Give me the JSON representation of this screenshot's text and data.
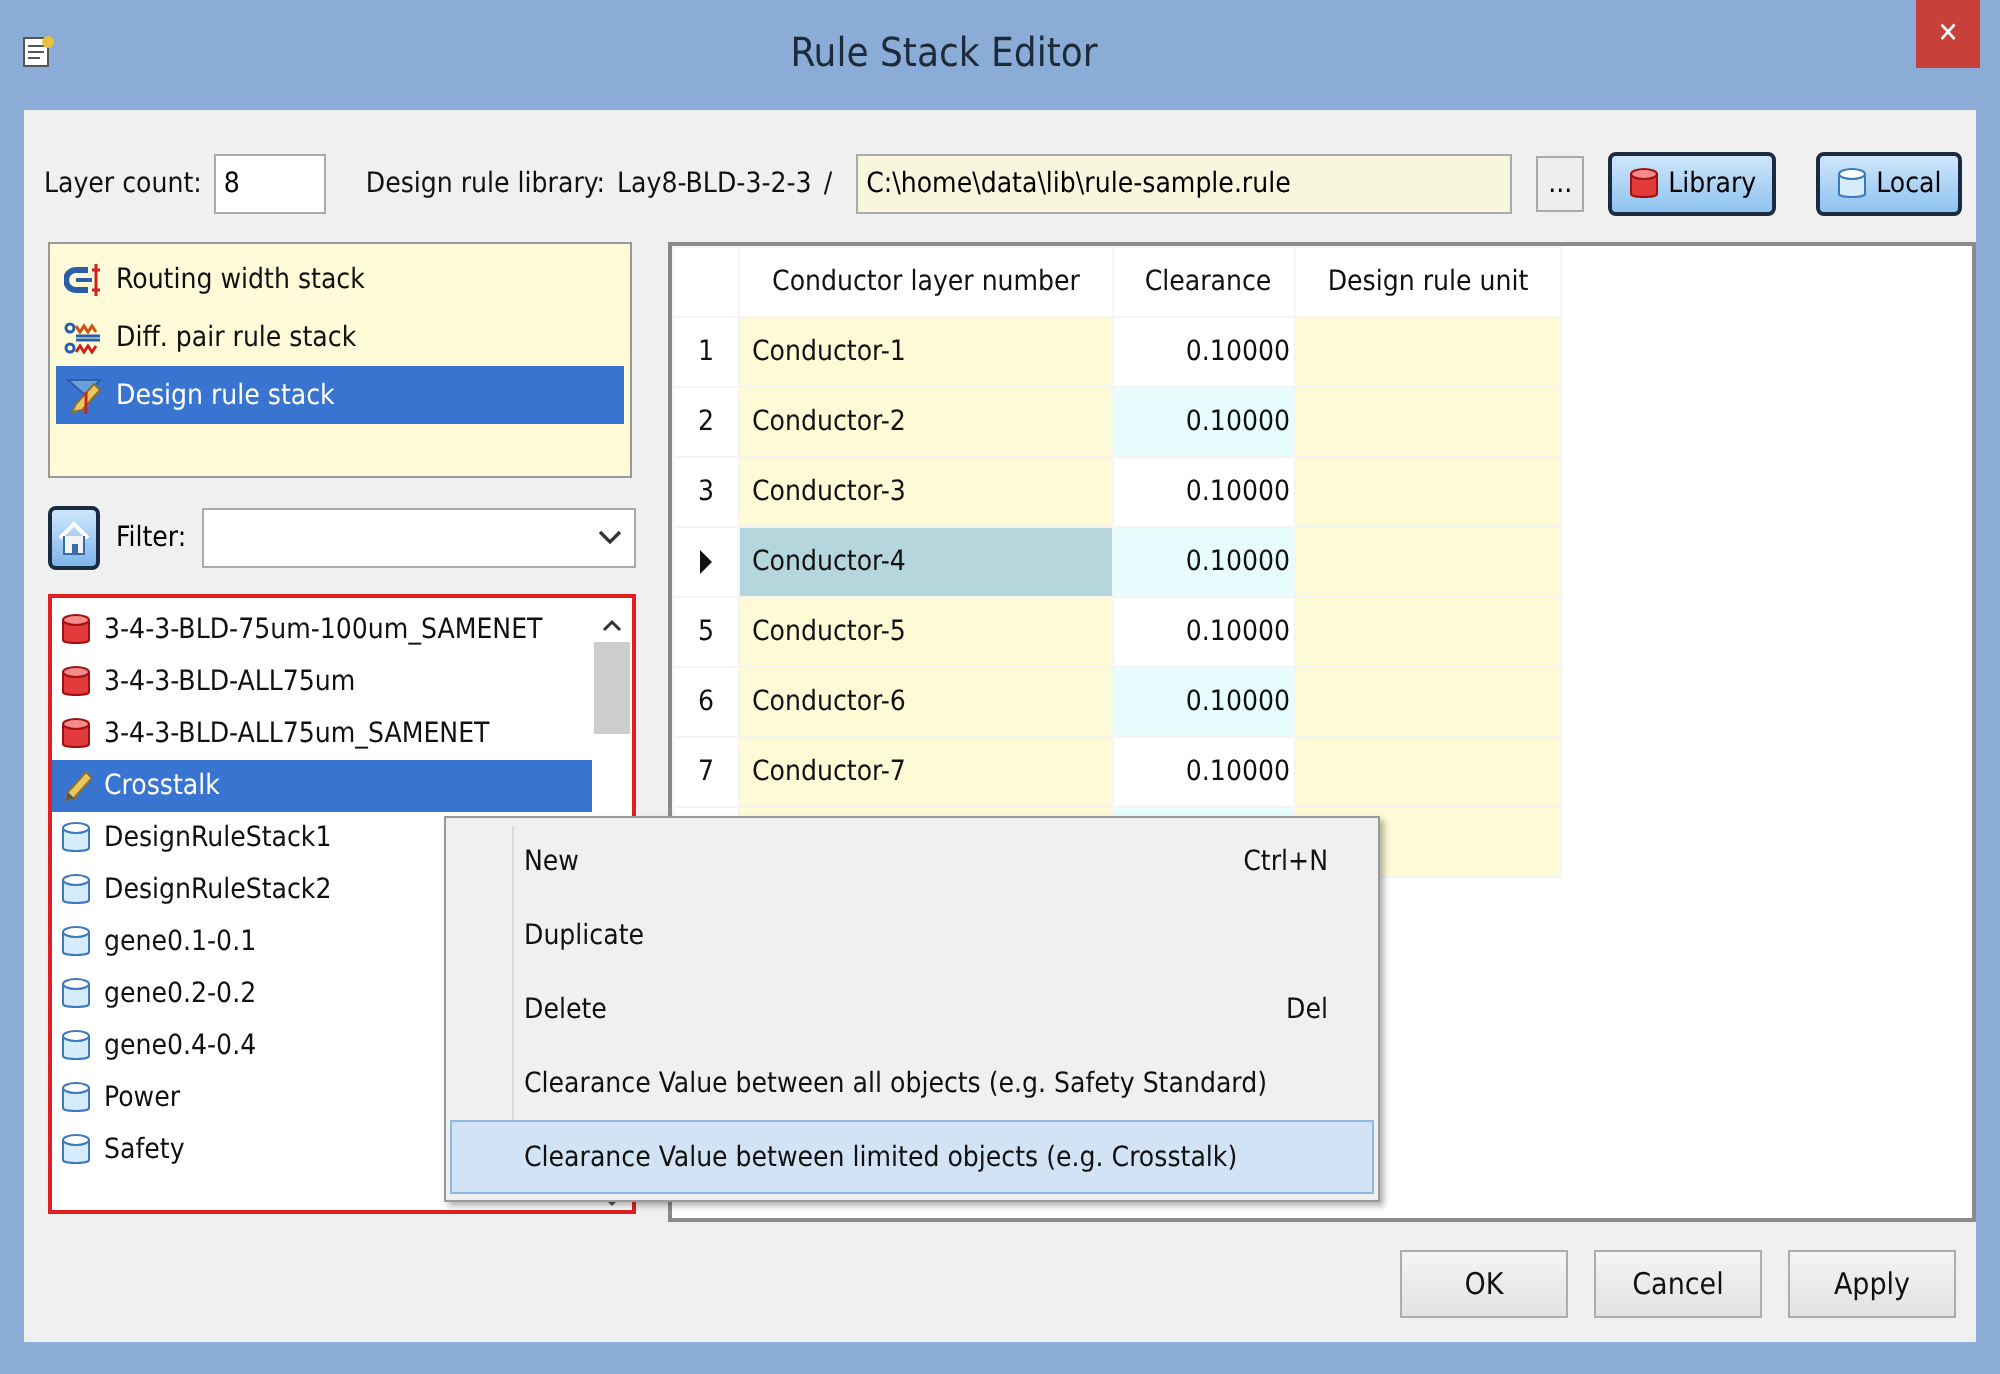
{
  "window": {
    "title": "Rule Stack Editor",
    "close": "✕"
  },
  "toolbar": {
    "layer_count_label": "Layer count:",
    "layer_count": "8",
    "library_label": "Design rule library:",
    "library_name": "Lay8-BLD-3-2-3",
    "separator": "/",
    "library_path": "C:\\home\\data\\lib\\rule-sample.rule",
    "browse": "...",
    "library_button": "Library",
    "local_button": "Local"
  },
  "stack_types": [
    {
      "label": "Routing width stack",
      "kind": "routing",
      "selected": false
    },
    {
      "label": "Diff. pair rule stack",
      "kind": "diffpair",
      "selected": false
    },
    {
      "label": "Design rule stack",
      "kind": "design",
      "selected": true
    }
  ],
  "filter": {
    "label": "Filter:"
  },
  "rule_stacks": [
    {
      "label": "3-4-3-BLD-75um-100um_SAMENET",
      "kind": "library",
      "selected": false
    },
    {
      "label": "3-4-3-BLD-ALL75um",
      "kind": "library",
      "selected": false
    },
    {
      "label": "3-4-3-BLD-ALL75um_SAMENET",
      "kind": "library",
      "selected": false
    },
    {
      "label": "Crosstalk",
      "kind": "edit",
      "selected": true
    },
    {
      "label": "DesignRuleStack1",
      "kind": "local",
      "selected": false
    },
    {
      "label": "DesignRuleStack2",
      "kind": "local",
      "selected": false
    },
    {
      "label": "gene0.1-0.1",
      "kind": "local",
      "selected": false
    },
    {
      "label": "gene0.2-0.2",
      "kind": "local",
      "selected": false
    },
    {
      "label": "gene0.4-0.4",
      "kind": "local",
      "selected": false
    },
    {
      "label": "Power",
      "kind": "local",
      "selected": false
    },
    {
      "label": "Safety",
      "kind": "local",
      "selected": false
    }
  ],
  "table": {
    "columns": [
      "Conductor layer number",
      "Clearance",
      "Design rule unit"
    ],
    "rows": [
      {
        "number": "1",
        "layer": "Conductor-1",
        "clearance": "0.10000",
        "current": false
      },
      {
        "number": "2",
        "layer": "Conductor-2",
        "clearance": "0.10000",
        "current": false
      },
      {
        "number": "3",
        "layer": "Conductor-3",
        "clearance": "0.10000",
        "current": false
      },
      {
        "layer": "Conductor-4",
        "clearance": "0.10000",
        "current": true
      },
      {
        "number": "5",
        "layer": "Conductor-5",
        "clearance": "0.10000",
        "current": false
      },
      {
        "number": "6",
        "layer": "Conductor-6",
        "clearance": "0.10000",
        "current": false
      },
      {
        "number": "7",
        "layer": "Conductor-7",
        "clearance": "0.10000",
        "current": false
      },
      {}
    ]
  },
  "context_menu": [
    {
      "label": "New",
      "shortcut": "Ctrl+N",
      "highlighted": false
    },
    {
      "label": "Duplicate",
      "highlighted": false
    },
    {
      "label": "Delete",
      "shortcut": "Del",
      "highlighted": false
    },
    {
      "label": "Clearance Value between all objects (e.g. Safety Standard)",
      "highlighted": false
    },
    {
      "label": "Clearance Value between limited objects (e.g. Crosstalk)",
      "highlighted": true
    }
  ],
  "buttons": [
    "OK",
    "Cancel",
    "Apply"
  ]
}
